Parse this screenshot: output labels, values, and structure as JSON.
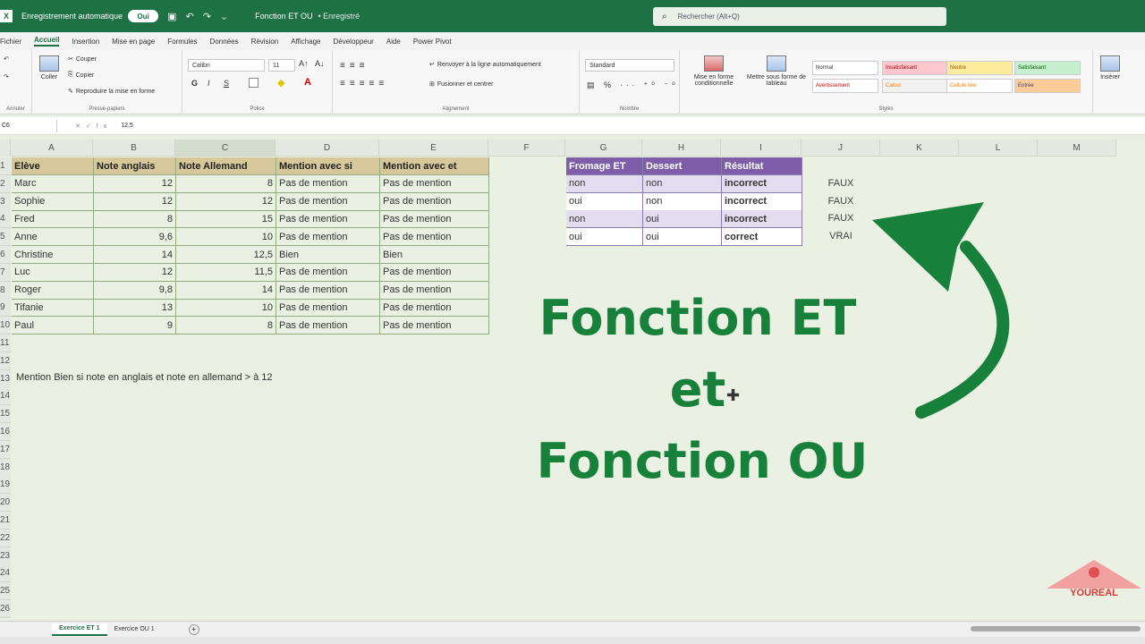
{
  "titlebar": {
    "logo": "X",
    "autosave_label": "Enregistrement automatique",
    "autosave_state": "Oui",
    "file_name": "Fonction ET OU",
    "saved_status": "• Enregistré",
    "search_placeholder": "Rechercher (Alt+Q)"
  },
  "menu": {
    "tabs": [
      "Fichier",
      "Accueil",
      "Insertion",
      "Mise en page",
      "Formules",
      "Données",
      "Révision",
      "Affichage",
      "Développeur",
      "Aide",
      "Power Pivot"
    ],
    "active": "Accueil"
  },
  "ribbon": {
    "clipboard": {
      "cut": "Couper",
      "copy": "Copier",
      "format_painter": "Reproduire la mise en forme",
      "paste": "Coller",
      "title": "Presse-papiers"
    },
    "font": {
      "name": "Calibri",
      "size": "11",
      "title": "Police"
    },
    "alignment": {
      "wrap": "Renvoyer à la ligne automatiquement",
      "merge": "Fusionner et centrer",
      "title": "Alignement"
    },
    "number": {
      "format": "Standard",
      "title": "Nombre"
    },
    "styles": {
      "conditional": "Mise en forme conditionnelle",
      "as_table": "Mettre sous forme de tableau",
      "cells": [
        "Normal",
        "Insatisfaisant",
        "Neutre",
        "Satisfaisant",
        "Avertissement",
        "Calcul",
        "Cellule liée",
        "Entrée"
      ],
      "title": "Styles"
    },
    "cells": {
      "insert": "Insérer"
    },
    "undo_group_title": "Annuler"
  },
  "formula_bar": {
    "name_box": "C6",
    "value": "12,5"
  },
  "columns": [
    "A",
    "B",
    "C",
    "D",
    "E",
    "F",
    "G",
    "H",
    "I",
    "J",
    "K",
    "L",
    "M"
  ],
  "rows": [
    "1",
    "2",
    "3",
    "4",
    "5",
    "6",
    "7",
    "8",
    "9",
    "10",
    "11",
    "12",
    "13",
    "14",
    "15",
    "16",
    "17",
    "18",
    "19",
    "20",
    "21",
    "22",
    "23",
    "24",
    "25",
    "26"
  ],
  "main_table": {
    "headers": [
      "Elève",
      "Note anglais",
      "Note Allemand",
      "Mention avec si",
      "Mention avec et"
    ],
    "rows": [
      [
        "Marc",
        "12",
        "8",
        "Pas de mention",
        "Pas de mention"
      ],
      [
        "Sophie",
        "12",
        "12",
        "Pas de mention",
        "Pas de mention"
      ],
      [
        "Fred",
        "8",
        "15",
        "Pas de mention",
        "Pas de mention"
      ],
      [
        "Anne",
        "9,6",
        "10",
        "Pas de mention",
        "Pas de mention"
      ],
      [
        "Christine",
        "14",
        "12,5",
        "Bien",
        "Bien"
      ],
      [
        "Luc",
        "12",
        "11,5",
        "Pas de mention",
        "Pas de mention"
      ],
      [
        "Roger",
        "9,8",
        "14",
        "Pas de mention",
        "Pas de mention"
      ],
      [
        "Tifanie",
        "13",
        "10",
        "Pas de mention",
        "Pas de mention"
      ],
      [
        "Paul",
        "9",
        "8",
        "Pas de mention",
        "Pas de mention"
      ]
    ]
  },
  "purple_table": {
    "headers": [
      "Fromage ET",
      "Dessert",
      "Résultat"
    ],
    "rows": [
      [
        "non",
        "non",
        "incorrect"
      ],
      [
        "oui",
        "non",
        "incorrect"
      ],
      [
        "non",
        "oui",
        "incorrect"
      ],
      [
        "oui",
        "oui",
        "correct"
      ]
    ]
  },
  "j_values": [
    "FAUX",
    "FAUX",
    "FAUX",
    "VRAI"
  ],
  "note": "Mention Bien si note en anglais et note en allemand > à 12",
  "overlay": {
    "line1": "Fonction ET",
    "line2": "et",
    "line3": "Fonction OU",
    "color": "#17803a"
  },
  "sheets": {
    "tabs": [
      "Exercice ET 1",
      "Exercice OU 1"
    ],
    "active": "Exercice ET 1"
  },
  "watermark": "YOUREAL",
  "colors": {
    "excel_green": "#1e7145",
    "table_header": "#d6c89a",
    "purple_header": "#7e5ea8",
    "purple_light": "#e4dcef"
  }
}
